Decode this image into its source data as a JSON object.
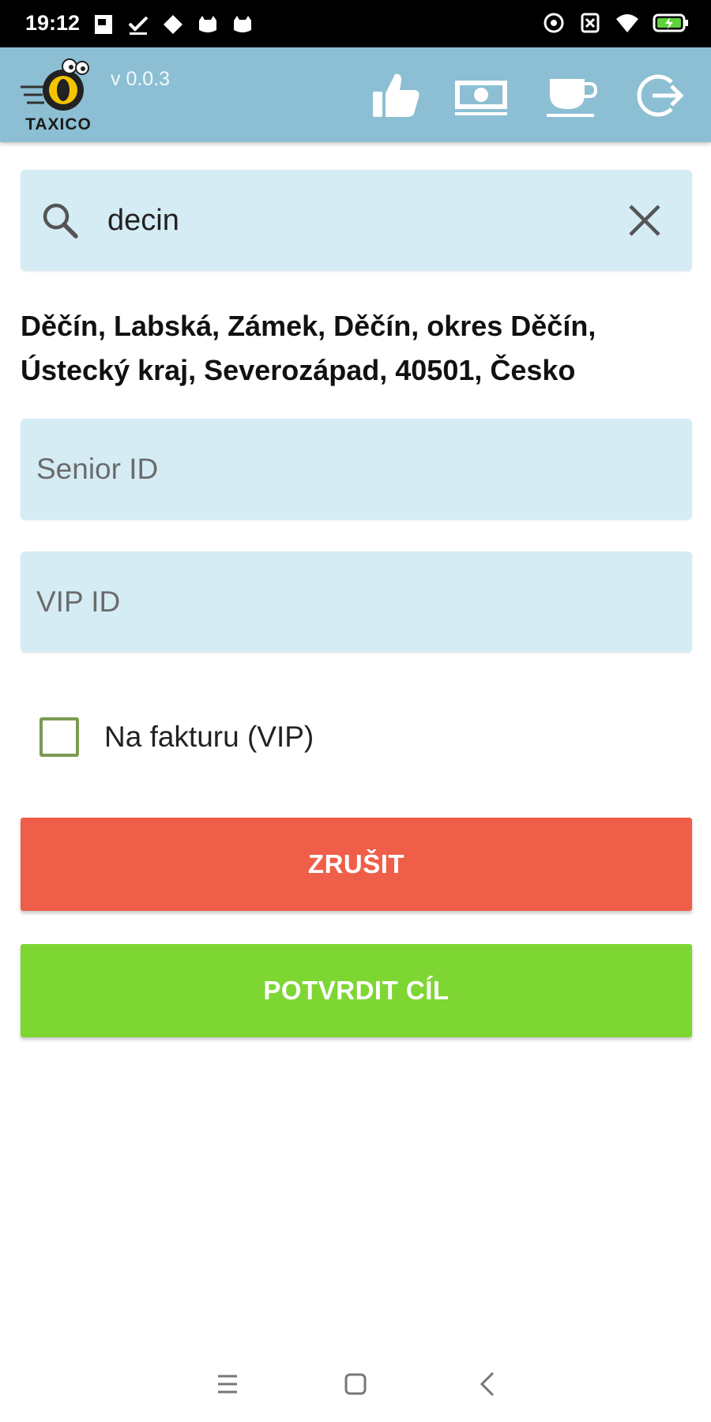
{
  "status_bar": {
    "time": "19:12"
  },
  "header": {
    "logo_text": "TAXICO",
    "version": "v 0.0.3",
    "icons": [
      "thumbs-up-icon",
      "cash-icon",
      "coffee-cup-icon",
      "logout-icon"
    ]
  },
  "search": {
    "value": "decin",
    "placeholder": ""
  },
  "address": {
    "text": "Děčín, Labská, Zámek, Děčín, okres Děčín, Ústecký kraj, Severozápad, 40501, Česko"
  },
  "form": {
    "senior_id_placeholder": "Senior ID",
    "senior_id_value": "",
    "vip_id_placeholder": "VIP ID",
    "vip_id_value": "",
    "invoice_label": "Na fakturu (VIP)",
    "invoice_checked": false
  },
  "buttons": {
    "cancel_label": "ZRUŠIT",
    "confirm_label": "POTVRDIT CÍL"
  },
  "colors": {
    "header_bg": "#8cbfd3",
    "field_bg": "#d5ecf5",
    "cancel": "#ef5e48",
    "confirm": "#7ed633"
  }
}
